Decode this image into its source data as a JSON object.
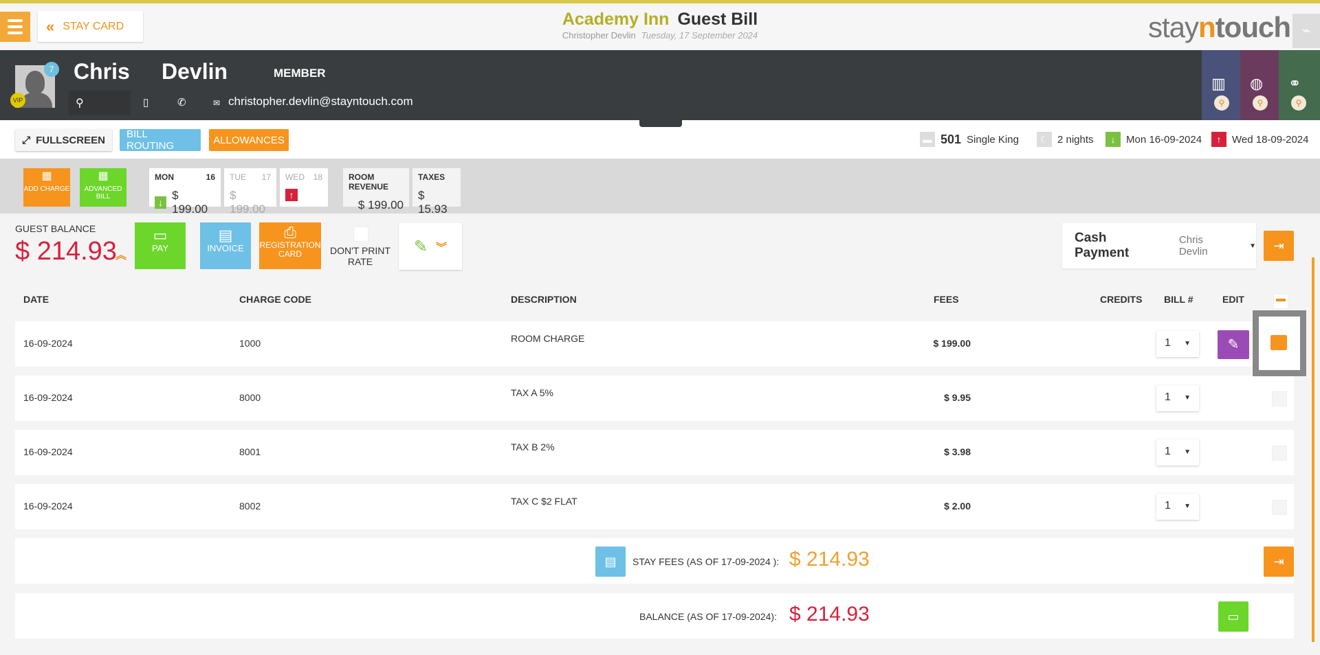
{
  "header": {
    "back_label": "STAY CARD",
    "hotel": "Academy Inn",
    "page": "Guest Bill",
    "guest_name": "Christopher Devlin",
    "date": "Tuesday, 17 September 2024",
    "logo": "stayntouch"
  },
  "guest": {
    "first_name": "Chris",
    "last_name": "Devlin",
    "membership": "MEMBER",
    "notification_count": "7",
    "vip": "VIP",
    "email": "christopher.devlin@stayntouch.com"
  },
  "actions": {
    "fullscreen": "FULLSCREEN",
    "bill_routing": "BILL ROUTING",
    "allowances": "ALLOWANCES"
  },
  "stay": {
    "room": "501",
    "room_type": "Single King",
    "nights": "2 nights",
    "arrival": "Mon 16-09-2024",
    "departure": "Wed 18-09-2024"
  },
  "tiles": {
    "add_charge": "ADD CHARGE",
    "advanced_bill": "ADVANCED BILL"
  },
  "days": [
    {
      "day": "MON",
      "num": "16",
      "amount": "$ 199.00"
    },
    {
      "day": "TUE",
      "num": "17",
      "amount": "$ 199.00"
    },
    {
      "day": "WED",
      "num": "18",
      "amount": ""
    }
  ],
  "totals": {
    "room_revenue_label": "ROOM REVENUE",
    "room_revenue": "$ 199.00",
    "taxes_label": "TAXES",
    "taxes": "$ 15.93"
  },
  "balance": {
    "label": "GUEST BALANCE",
    "value": "$ 214.93"
  },
  "buttons": {
    "pay": "PAY",
    "invoice": "INVOICE",
    "registration_card": "REGISTRATION CARD",
    "dont_print_rate": "DON'T PRINT RATE"
  },
  "payment": {
    "method": "Cash Payment",
    "payer": "Chris Devlin"
  },
  "table": {
    "headers": {
      "date": "DATE",
      "code": "CHARGE CODE",
      "description": "DESCRIPTION",
      "fees": "FEES",
      "credits": "CREDITS",
      "bill": "BILL #",
      "edit": "EDIT"
    },
    "rows": [
      {
        "date": "16-09-2024",
        "code": "1000",
        "description": "ROOM CHARGE",
        "fees": "$ 199.00",
        "bill": "1"
      },
      {
        "date": "16-09-2024",
        "code": "8000",
        "description": "TAX A 5%",
        "fees": "$ 9.95",
        "bill": "1"
      },
      {
        "date": "16-09-2024",
        "code": "8001",
        "description": "TAX B 2%",
        "fees": "$ 3.98",
        "bill": "1"
      },
      {
        "date": "16-09-2024",
        "code": "8002",
        "description": "TAX C $2 FLAT",
        "fees": "$ 2.00",
        "bill": "1"
      }
    ]
  },
  "summary": {
    "stay_fees_label": "STAY FEES (AS OF  17-09-2024 ):",
    "stay_fees": "$ 214.93",
    "balance_label": "BALANCE (AS OF  17-09-2024):",
    "balance": "$ 214.93"
  },
  "colors": {
    "accent": "#f7941d",
    "balance": "#d6213c",
    "pay": "#6cd62b",
    "invoice": "#6ec0e6",
    "edit": "#9b4bb6"
  }
}
